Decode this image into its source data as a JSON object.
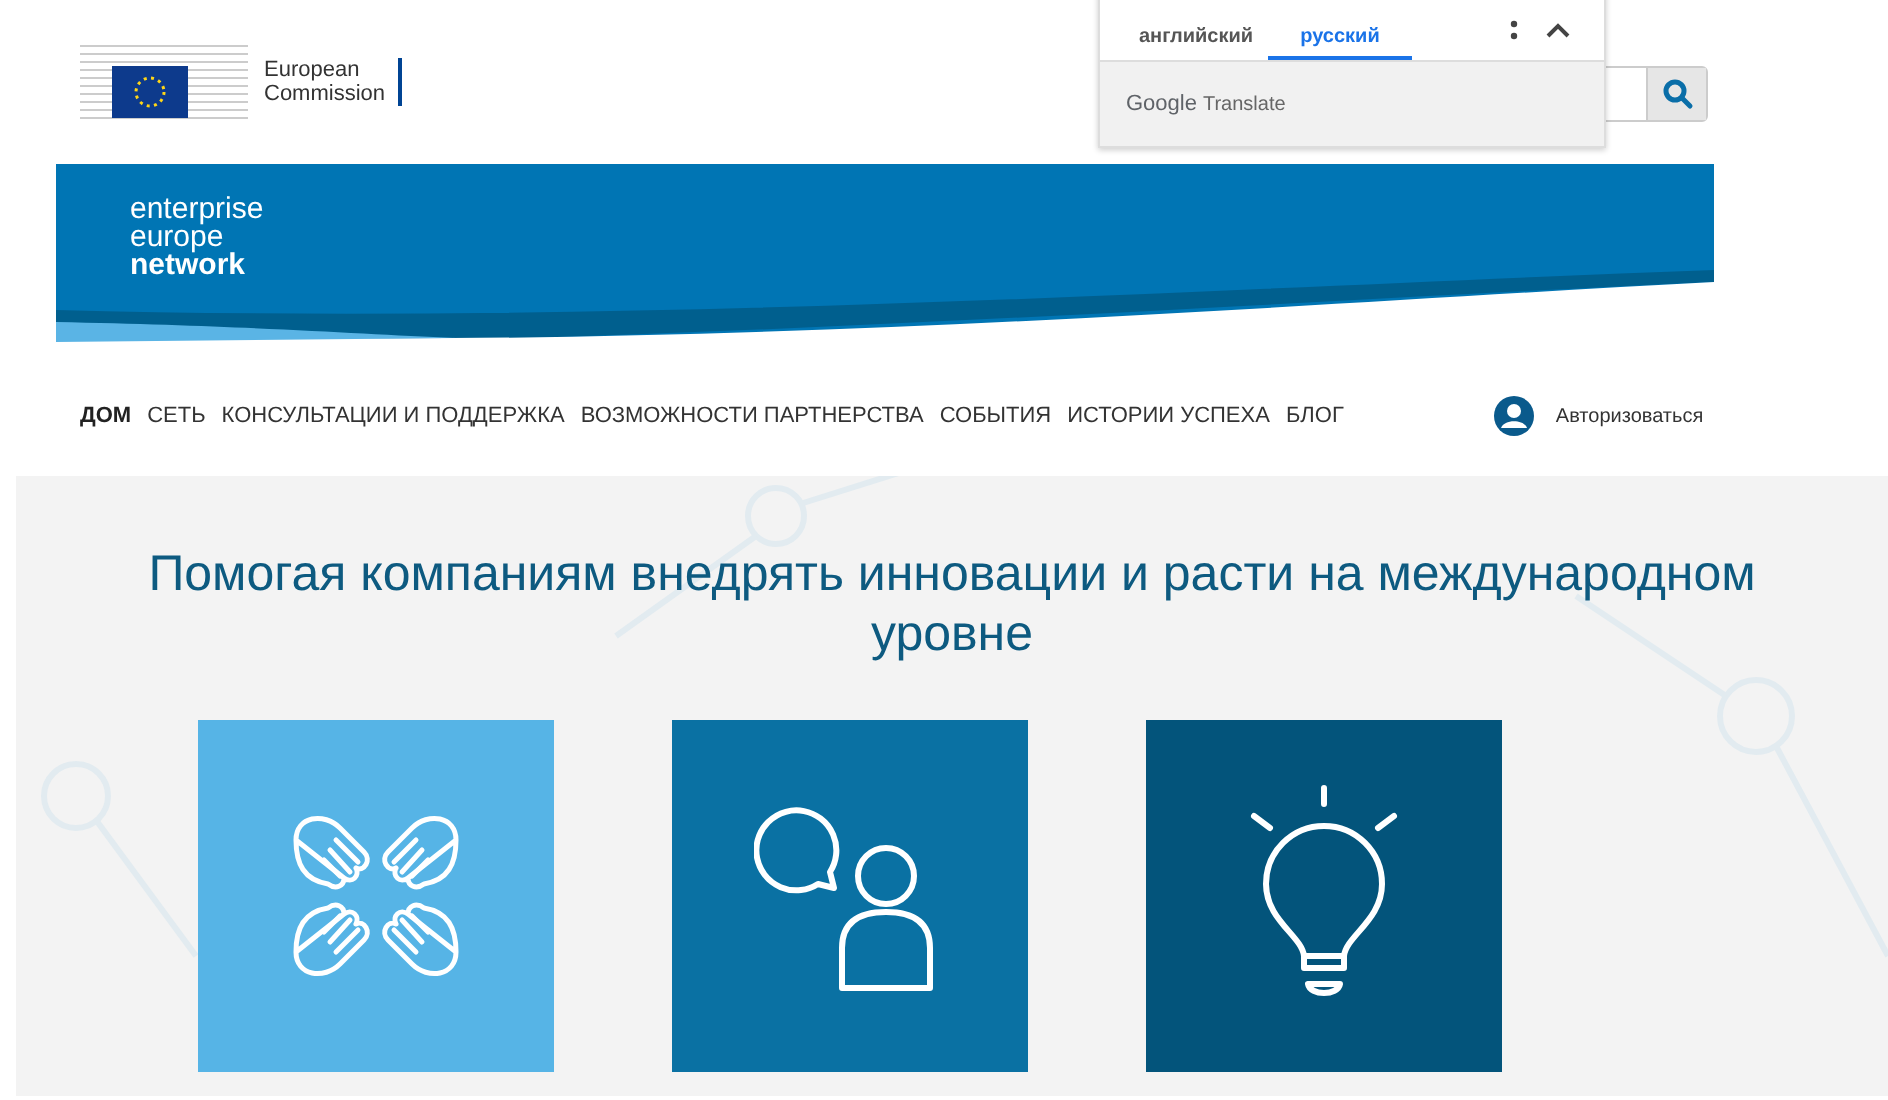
{
  "header": {
    "commission_name": [
      "European",
      "Commission"
    ]
  },
  "translate_popup": {
    "tabs": [
      {
        "label": "английский",
        "selected": false
      },
      {
        "label": "русский",
        "selected": true
      }
    ],
    "footer": {
      "brand": "Google",
      "product": "Translate"
    }
  },
  "banner": {
    "logo_lines": [
      "enterprise",
      "europe",
      "network"
    ]
  },
  "nav": {
    "items": [
      {
        "label": "ДОМ",
        "selected": true
      },
      {
        "label": "СЕТЬ",
        "selected": false
      },
      {
        "label": "КОНСУЛЬТАЦИИ И ПОДДЕРЖКА",
        "selected": false
      },
      {
        "label": "ВОЗМОЖНОСТИ ПАРТНЕРСТВА",
        "selected": false
      },
      {
        "label": "СОБЫТИЯ",
        "selected": false
      },
      {
        "label": "ИСТОРИИ УСПЕХА",
        "selected": false
      },
      {
        "label": "БЛОГ",
        "selected": false
      }
    ],
    "login": "Авторизоваться"
  },
  "hero": {
    "heading": "Помогая компаниям внедрять инновации и расти на международном уровне",
    "tiles": [
      {
        "kind": "hands",
        "color": "#56b4e6"
      },
      {
        "kind": "advice",
        "color": "#0a71a3"
      },
      {
        "kind": "idea",
        "color": "#03547b"
      }
    ]
  }
}
